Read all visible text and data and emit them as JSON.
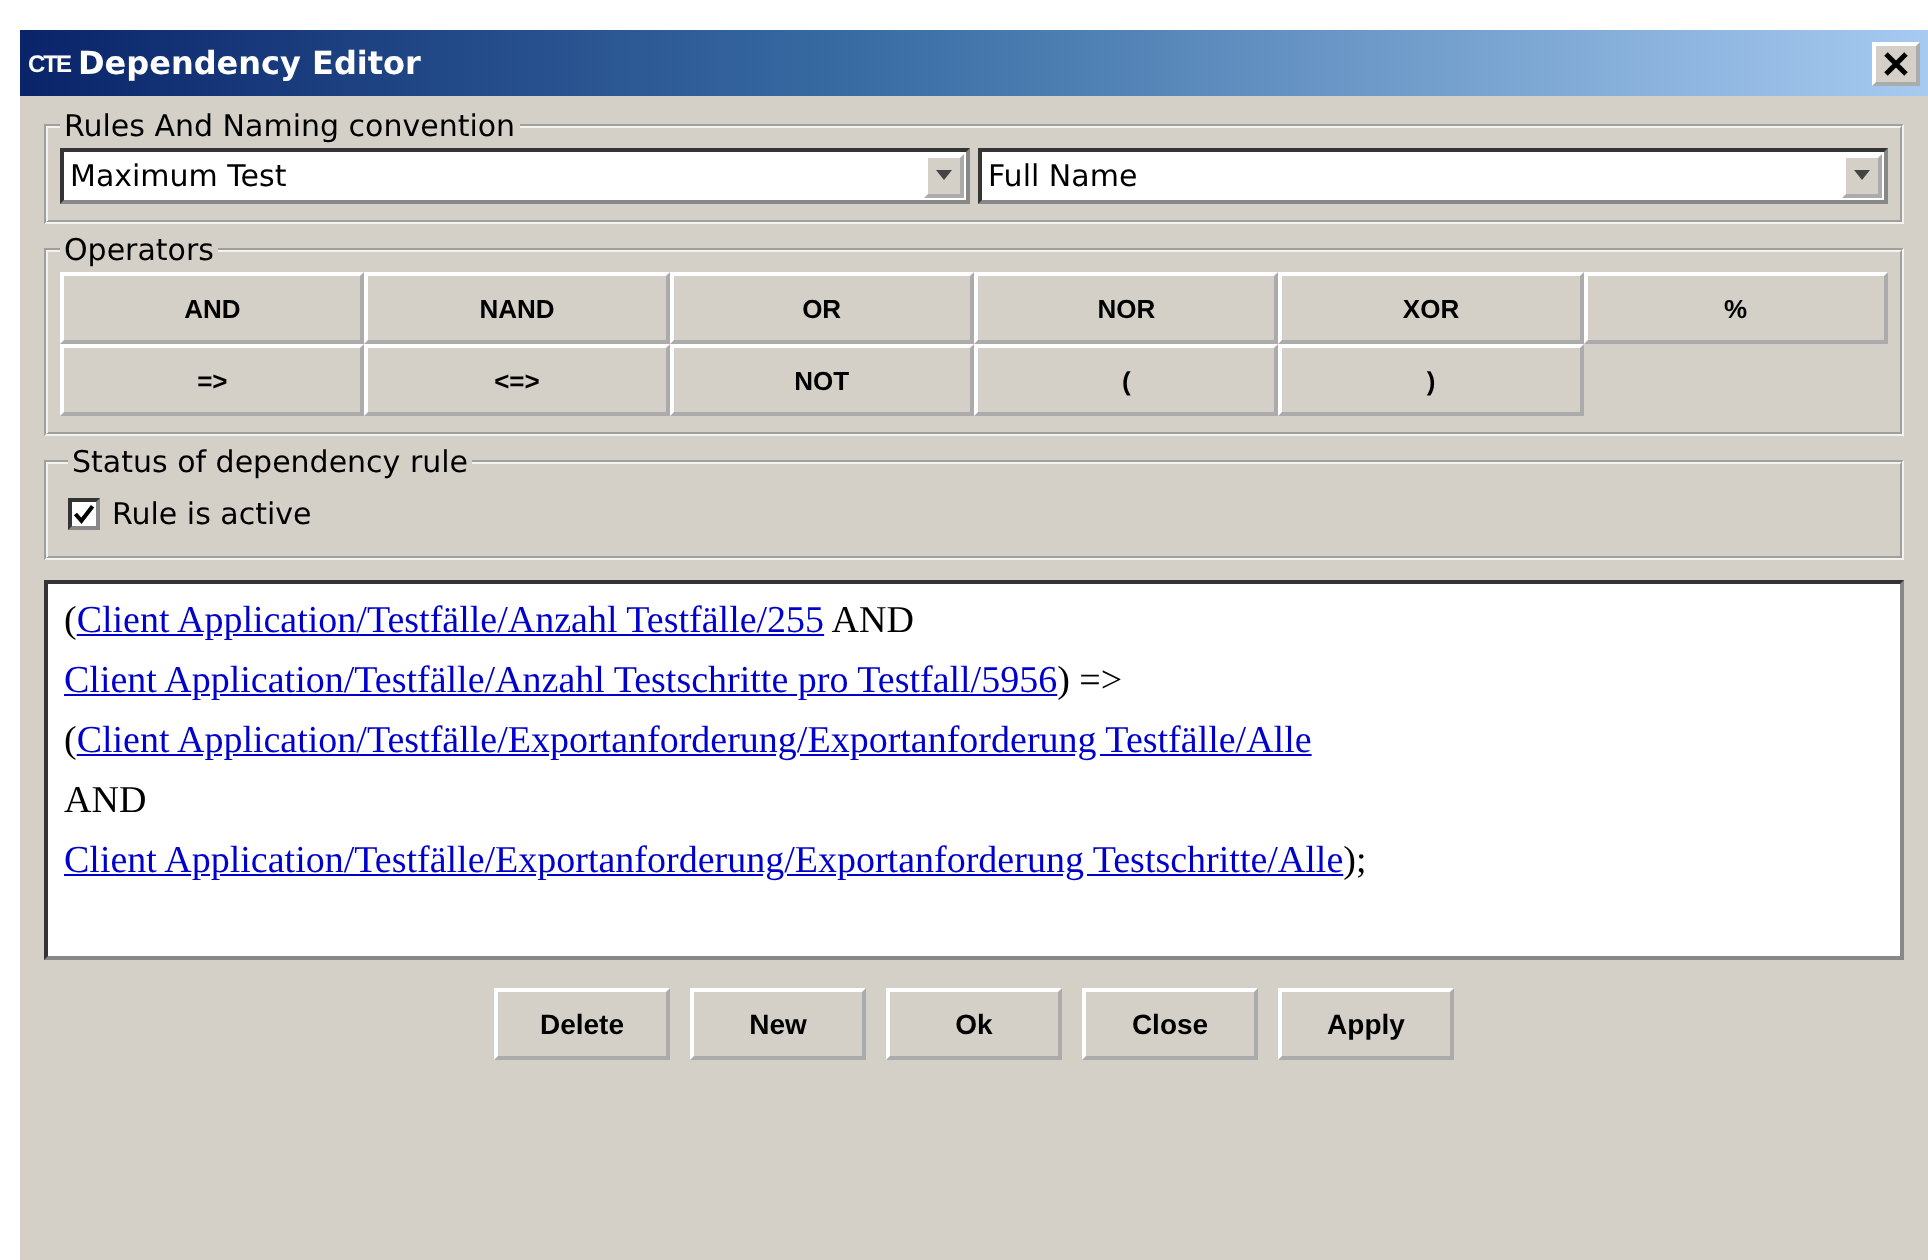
{
  "window": {
    "logo": "CTE",
    "title": "Dependency Editor"
  },
  "rules_group": {
    "label": "Rules And Naming convention",
    "rule_select": {
      "value": "Maximum Test"
    },
    "naming_select": {
      "value": "Full Name"
    }
  },
  "operators_group": {
    "label": "Operators",
    "rows": [
      [
        "AND",
        "NAND",
        "OR",
        "NOR",
        "XOR",
        "%"
      ],
      [
        "=>",
        "<=>",
        "NOT",
        "(",
        ")"
      ]
    ]
  },
  "status_group": {
    "label": "Status of dependency rule",
    "checkbox": {
      "label": "Rule is active",
      "checked": true
    }
  },
  "expression": {
    "lines": [
      [
        {
          "kind": "text",
          "text": "("
        },
        {
          "kind": "link",
          "text": "Client Application/Testfälle/Anzahl Testfälle/255"
        },
        {
          "kind": "text",
          "text": " AND"
        }
      ],
      [
        {
          "kind": "link",
          "text": "Client Application/Testfälle/Anzahl Testschritte pro Testfall/5956"
        },
        {
          "kind": "text",
          "text": ") =>"
        }
      ],
      [
        {
          "kind": "text",
          "text": "("
        },
        {
          "kind": "link",
          "text": "Client Application/Testfälle/Exportanforderung/Exportanforderung Testfälle/Alle"
        }
      ],
      [
        {
          "kind": "text",
          "text": "AND"
        }
      ],
      [
        {
          "kind": "link",
          "text": "Client Application/Testfälle/Exportanforderung/Exportanforderung Testschritte/Alle"
        },
        {
          "kind": "text",
          "text": ");"
        }
      ]
    ]
  },
  "buttons": [
    "Delete",
    "New",
    "Ok",
    "Close",
    "Apply"
  ]
}
